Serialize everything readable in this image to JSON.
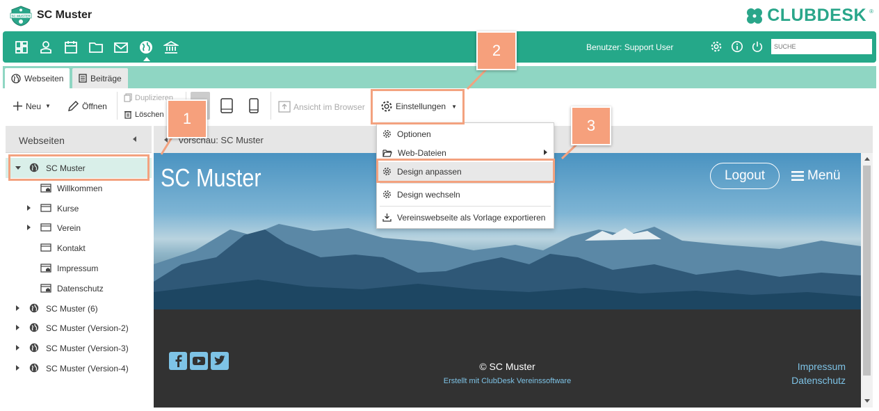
{
  "app": {
    "title": "SC Muster",
    "logo_text": "SC MUSTER",
    "brand": "CLUBDESK",
    "brand_reg": "®"
  },
  "nav": {
    "icons": [
      "dashboard-icon",
      "person-icon",
      "calendar-icon",
      "folder-icon",
      "mail-icon",
      "globe-icon",
      "bank-icon"
    ],
    "user_label": "Benutzer: Support User",
    "search_placeholder": "SUCHE"
  },
  "tabs": [
    {
      "label": "Webseiten",
      "icon": "globe-icon",
      "active": true
    },
    {
      "label": "Beiträge",
      "icon": "document-icon",
      "active": false
    }
  ],
  "toolbar": {
    "new_label": "Neu",
    "open_label": "Öffnen",
    "duplicate_label": "Duplizieren",
    "delete_label": "Löschen",
    "browser_label": "Ansicht im Browser",
    "settings_label": "Einstellungen"
  },
  "left_panel": {
    "title": "Webseiten",
    "tree": [
      {
        "label": "SC Muster",
        "level": 0,
        "expanded": true,
        "selected": true,
        "icon": "globe-icon"
      },
      {
        "label": "Willkommen",
        "level": 1,
        "icon": "home-page-icon"
      },
      {
        "label": "Kurse",
        "level": 1,
        "has_children": true,
        "icon": "page-icon"
      },
      {
        "label": "Verein",
        "level": 1,
        "has_children": true,
        "icon": "page-icon"
      },
      {
        "label": "Kontakt",
        "level": 1,
        "icon": "page-icon"
      },
      {
        "label": "Impressum",
        "level": 1,
        "icon": "home-page-icon"
      },
      {
        "label": "Datenschutz",
        "level": 1,
        "icon": "home-page-icon"
      },
      {
        "label": "SC Muster (6)",
        "level": 0,
        "has_children": true,
        "icon": "globe-icon"
      },
      {
        "label": "SC Muster (Version-2)",
        "level": 0,
        "has_children": true,
        "icon": "globe-icon"
      },
      {
        "label": "SC Muster (Version-3)",
        "level": 0,
        "has_children": true,
        "icon": "globe-icon"
      },
      {
        "label": "SC Muster (Version-4)",
        "level": 0,
        "has_children": true,
        "icon": "globe-icon"
      }
    ]
  },
  "preview": {
    "label": "Vorschau: SC Muster",
    "site_title": "SC Muster",
    "logout_label": "Logout",
    "menu_label": "Menü",
    "copyright": "© SC Muster",
    "credit": "Erstellt mit ClubDesk Vereinssoftware",
    "footer_links": [
      "Impressum",
      "Datenschutz"
    ]
  },
  "dropdown": {
    "items": [
      {
        "label": "Optionen",
        "icon": "gear-icon"
      },
      {
        "label": "Web-Dateien",
        "icon": "folder-open-icon",
        "submenu": true
      },
      {
        "label": "Design anpassen",
        "icon": "gear-icon",
        "highlighted": true
      },
      {
        "label": "Design wechseln",
        "icon": "gear-icon"
      },
      {
        "label": "Vereinswebseite als Vorlage exportieren",
        "icon": "download-icon"
      }
    ]
  },
  "callouts": [
    "1",
    "2",
    "3"
  ],
  "colors": {
    "brand_green": "#25a889",
    "tab_strip": "#8fd6c3",
    "callout": "#f6a07c",
    "link_blue": "#7ec3e6"
  }
}
